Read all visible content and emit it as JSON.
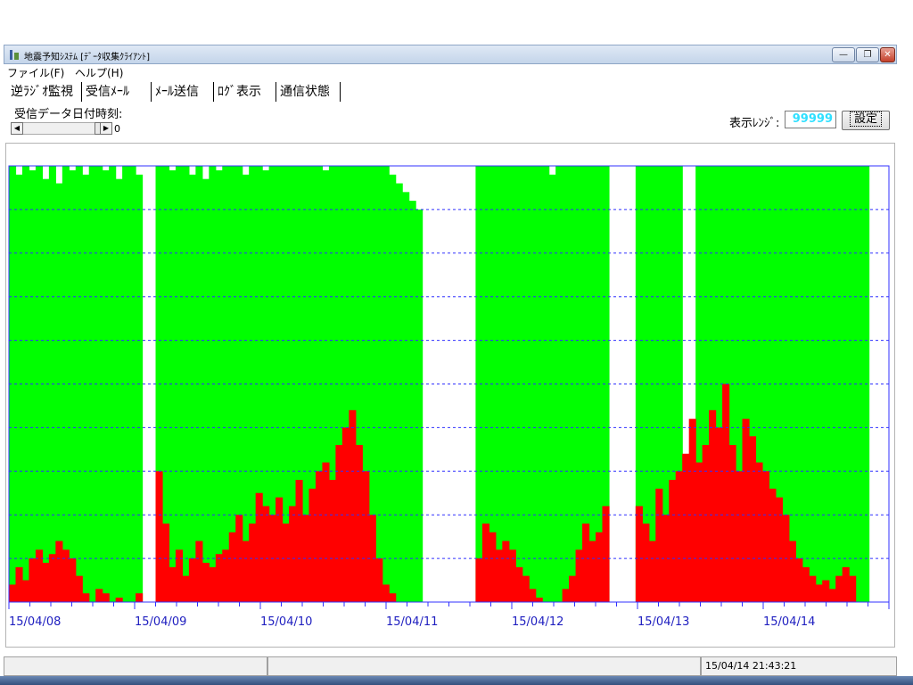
{
  "window": {
    "title": "地震予知ｼｽﾃﾑ [ﾃﾞｰﾀ収集ｸﾗｲｱﾝﾄ]",
    "buttons": {
      "minimize": "—",
      "restore": "❐",
      "close": "✕"
    }
  },
  "menu": [
    {
      "label": "ファイル(F)"
    },
    {
      "label": "ヘルプ(H)"
    }
  ],
  "tabs": [
    {
      "label": "逆ﾗｼﾞｵ監視"
    },
    {
      "label": "受信ﾒｰﾙ"
    },
    {
      "label": "ﾒｰﾙ送信"
    },
    {
      "label": "ﾛｸﾞ表示"
    },
    {
      "label": "通信状態"
    }
  ],
  "controls": {
    "date_label": "受信データ日付時刻:",
    "scroll_value": "0",
    "range_label": "表示ﾚﾝｼﾞ:",
    "range_value": "99999",
    "set_button": "設定"
  },
  "chart_data": {
    "type": "area",
    "x_tick_labels": [
      "15/04/08",
      "15/04/09",
      "15/04/10",
      "15/04/11",
      "15/04/12",
      "15/04/13",
      "15/04/14"
    ],
    "x_range": [
      "15/04/08 00:00",
      "15/04/14 21:43"
    ],
    "y_range": [
      0,
      99999
    ],
    "grid": true,
    "colors": {
      "upper": "#00ff00",
      "lower": "#ff0000",
      "grid": "#3030ff",
      "tick_text": "#2020c0"
    },
    "series": [
      {
        "values_upper": [
          100,
          98,
          100,
          99,
          100,
          97,
          100,
          96,
          100,
          99,
          100,
          98,
          100,
          100,
          99,
          100,
          97,
          100,
          100,
          98,
          0,
          0,
          100,
          100,
          99,
          100,
          100,
          98,
          100,
          97,
          100,
          99,
          100,
          100,
          100,
          98,
          100,
          100,
          99,
          100,
          100,
          100,
          100,
          100,
          100,
          100,
          100,
          99,
          100,
          100,
          100,
          100,
          100,
          100,
          100,
          100,
          100,
          98,
          96,
          94,
          92,
          90,
          0,
          0,
          0,
          0,
          0,
          0,
          0,
          0,
          100,
          100,
          100,
          100,
          100,
          100,
          100,
          100,
          100,
          100,
          100,
          98,
          100,
          100,
          100,
          100,
          100,
          100,
          100,
          100,
          0,
          0,
          0,
          0,
          100,
          100,
          100,
          100,
          100,
          100,
          100,
          0,
          0,
          100,
          100,
          100,
          100,
          100,
          100,
          100,
          100,
          100,
          100,
          100,
          100,
          100,
          100,
          100,
          100,
          100,
          100,
          100,
          100,
          100,
          100,
          100,
          100,
          100,
          100,
          0,
          0,
          0
        ],
        "values_lower": [
          4,
          8,
          5,
          10,
          12,
          9,
          11,
          14,
          12,
          10,
          6,
          2,
          0,
          3,
          2,
          0,
          1,
          0,
          0,
          2,
          0,
          0,
          30,
          18,
          8,
          12,
          6,
          10,
          14,
          9,
          8,
          11,
          12,
          16,
          20,
          14,
          18,
          25,
          22,
          20,
          24,
          18,
          22,
          28,
          20,
          26,
          30,
          32,
          28,
          36,
          40,
          44,
          36,
          30,
          20,
          10,
          4,
          2,
          0,
          0,
          0,
          0,
          0,
          0,
          0,
          0,
          0,
          0,
          0,
          0,
          10,
          18,
          16,
          12,
          14,
          12,
          8,
          6,
          3,
          1,
          0,
          0,
          0,
          3,
          6,
          12,
          18,
          14,
          16,
          22,
          0,
          0,
          0,
          0,
          22,
          18,
          14,
          26,
          20,
          28,
          30,
          34,
          42,
          32,
          36,
          44,
          40,
          50,
          36,
          30,
          42,
          38,
          32,
          30,
          26,
          24,
          20,
          14,
          10,
          8,
          6,
          4,
          5,
          3,
          6,
          8,
          6,
          0,
          0,
          0,
          0,
          0,
          0,
          0
        ]
      }
    ]
  },
  "status": {
    "pane1": "",
    "pane2": "",
    "datetime": "15/04/14 21:43:21"
  }
}
